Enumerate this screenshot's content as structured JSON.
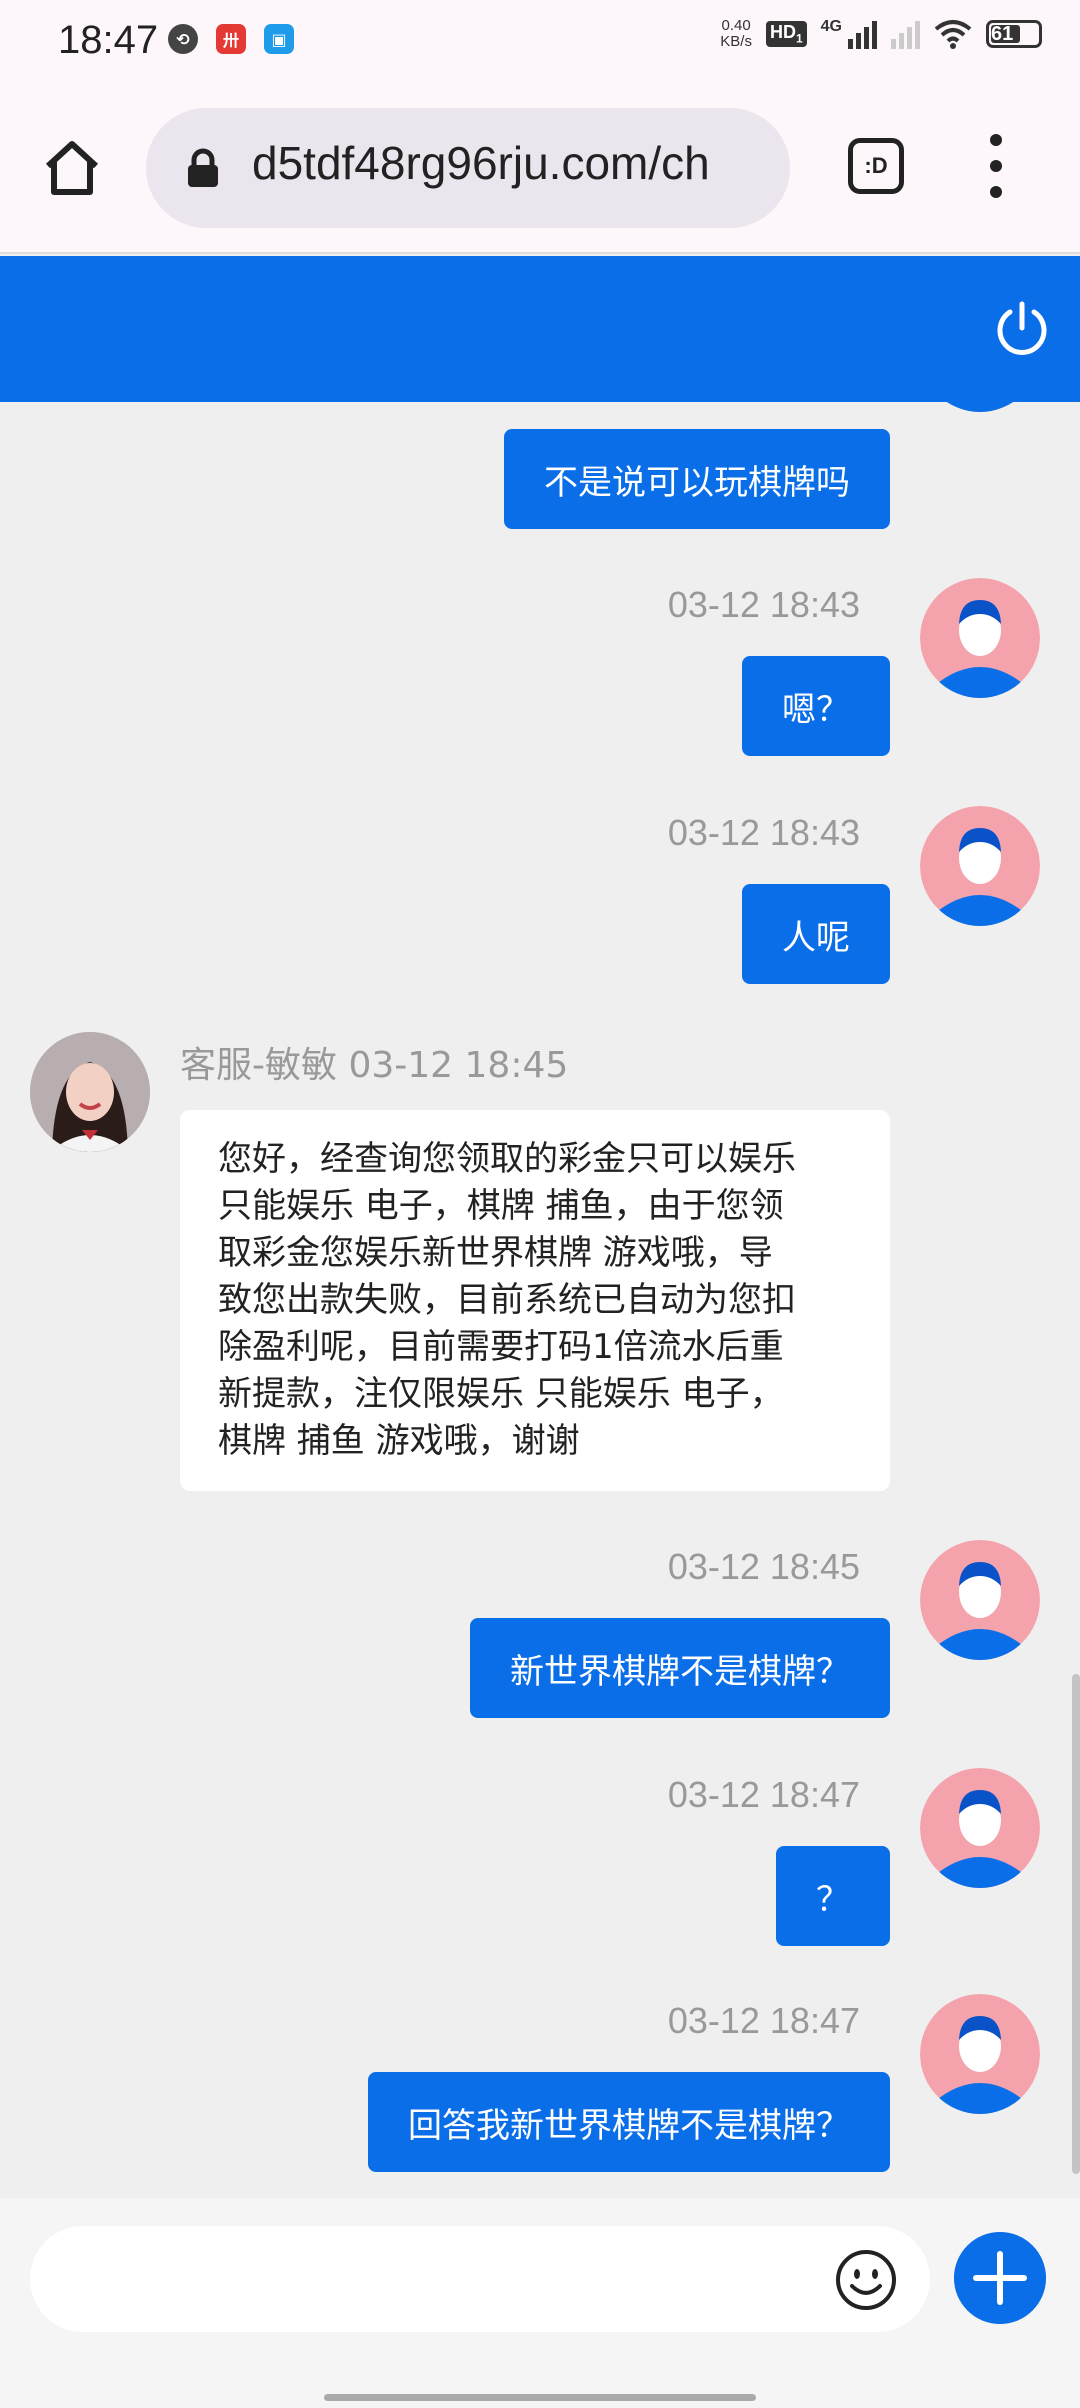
{
  "status_bar": {
    "time": "18:47",
    "net_speed_value": "0.40",
    "net_speed_unit": "KB/s",
    "hd_label": "HD",
    "hd_sub": "1",
    "network_type": "4G",
    "battery_level": "61",
    "icons": [
      "app-icon-1",
      "app-icon-2",
      "app-icon-3",
      "wifi-icon",
      "battery-icon"
    ]
  },
  "browser": {
    "url": "d5tdf48rg96rju.com/ch",
    "tab_switcher_label": ":D"
  },
  "chat": {
    "messages": [
      {
        "from": "user",
        "text": "不是说可以玩棋牌吗"
      },
      {
        "from": "user",
        "time": "03-12 18:43",
        "text": "嗯？"
      },
      {
        "from": "user",
        "time": "03-12 18:43",
        "text": "人呢"
      },
      {
        "from": "agent",
        "agent_name": "客服-敏敏",
        "time": "03-12 18:45",
        "lines": [
          "您好，经查询您领取的彩金只可以娱乐",
          "只能娱乐 电子，棋牌 捕鱼，由于您领",
          "取彩金您娱乐新世界棋牌 游戏哦，导",
          "致您出款失败，目前系统已自动为您扣",
          "除盈利呢，目前需要打码1倍流水后重",
          "新提款，注仅限娱乐 只能娱乐 电子，",
          "棋牌 捕鱼 游戏哦，谢谢"
        ]
      },
      {
        "from": "user",
        "time": "03-12 18:45",
        "text": "新世界棋牌不是棋牌？"
      },
      {
        "from": "user",
        "time": "03-12 18:47",
        "text": "？"
      },
      {
        "from": "user",
        "time": "03-12 18:47",
        "text": "回答我新世界棋牌不是棋牌？"
      }
    ]
  },
  "input": {
    "value": "",
    "placeholder": ""
  },
  "colors": {
    "accent": "#0a6ee8",
    "chat_background": "#efefef",
    "avatar_background": "#f4a3ac"
  }
}
